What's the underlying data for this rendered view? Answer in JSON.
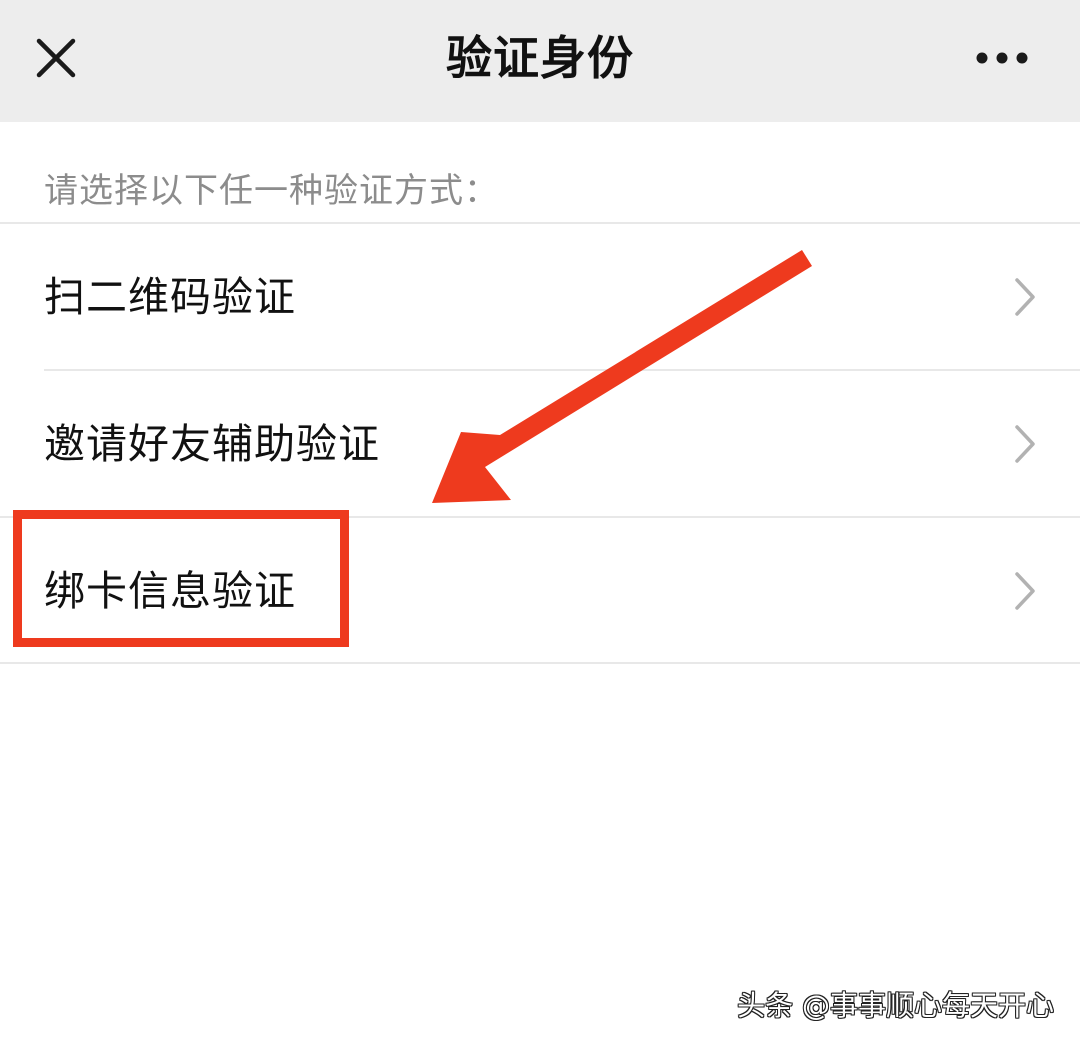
{
  "nav": {
    "title": "验证身份",
    "close_icon": "close-icon",
    "more_icon": "more-horizontal-icon"
  },
  "section": {
    "hint": "请选择以下任一种验证方式："
  },
  "options": [
    {
      "label": "扫二维码验证",
      "icon": "chevron-right-icon"
    },
    {
      "label": "邀请好友辅助验证",
      "icon": "chevron-right-icon"
    },
    {
      "label": "绑卡信息验证",
      "icon": "chevron-right-icon"
    }
  ],
  "annotation": {
    "color": "#ee3a1e",
    "highlighted_option": "绑卡信息验证"
  },
  "watermark": {
    "text": "头条 @事事顺心每天开心"
  }
}
